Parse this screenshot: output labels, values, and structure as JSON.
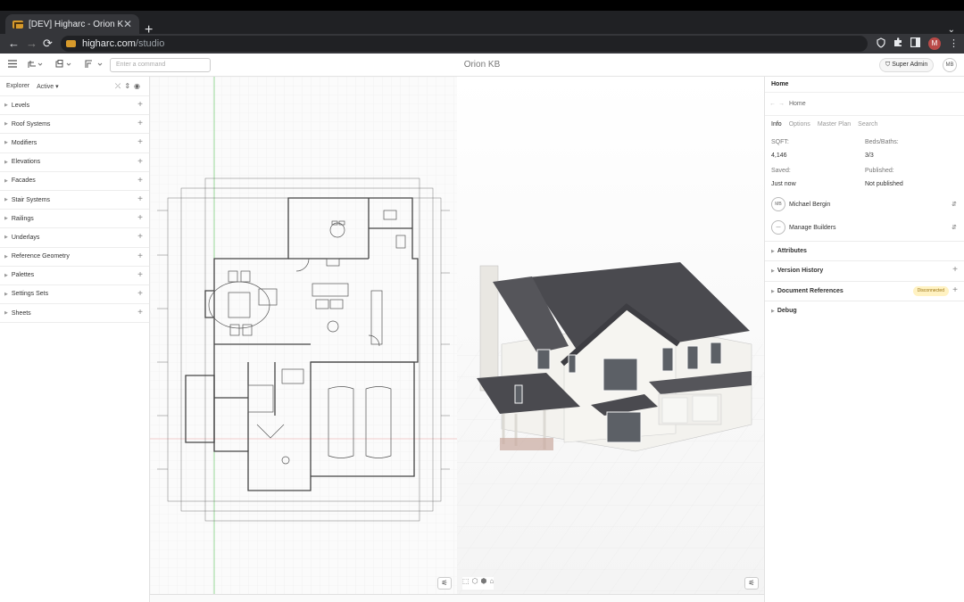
{
  "browser": {
    "tab_title": "[DEV] Higharc - Orion KB",
    "tab_close": "✕",
    "new_tab": "+",
    "tab_menu": "⌄",
    "url_host": "higharc.com",
    "url_path": "/studio",
    "profile_initial": "M",
    "back": "←",
    "forward": "→",
    "reload": "⟳",
    "kebab": "⋮"
  },
  "app_toolbar": {
    "command_placeholder": "Enter a command",
    "title": "Orion KB",
    "role_button": "Super Admin",
    "user_initials": "MB"
  },
  "explorer": {
    "title": "Explorer",
    "filter": "Active",
    "items": [
      {
        "label": "Levels"
      },
      {
        "label": "Roof Systems"
      },
      {
        "label": "Modifiers"
      },
      {
        "label": "Elevations"
      },
      {
        "label": "Facades"
      },
      {
        "label": "Stair Systems"
      },
      {
        "label": "Railings"
      },
      {
        "label": "Underlays"
      },
      {
        "label": "Reference Geometry"
      },
      {
        "label": "Palettes"
      },
      {
        "label": "Settings Sets"
      },
      {
        "label": "Sheets"
      }
    ]
  },
  "inspector": {
    "title": "Home",
    "breadcrumb": "Home",
    "tabs": [
      {
        "label": "Info",
        "active": true
      },
      {
        "label": "Options",
        "active": false
      },
      {
        "label": "Master Plan",
        "active": false
      },
      {
        "label": "Search",
        "active": false
      }
    ],
    "sqft_label": "SQFT:",
    "sqft_value": "4,146",
    "beds_label": "Beds/Baths:",
    "beds_value": "3/3",
    "saved_label": "Saved:",
    "saved_value": "Just now",
    "published_label": "Published:",
    "published_value": "Not published",
    "owner_initials": "MB",
    "owner_name": "Michael Bergin",
    "manage_icon_text": "—",
    "manage_label": "Manage Builders",
    "sections": {
      "attributes": "Attributes",
      "version_history": "Version History",
      "document_references": "Document References",
      "doc_status": "Disconnected",
      "debug": "Debug"
    }
  },
  "colors": {
    "plan_line": "#5a5a5a",
    "grid": "#e8e8e8",
    "roof": "#4a4a4f",
    "siding": "#f3f2ee",
    "badge_bg": "#fff2c2"
  }
}
